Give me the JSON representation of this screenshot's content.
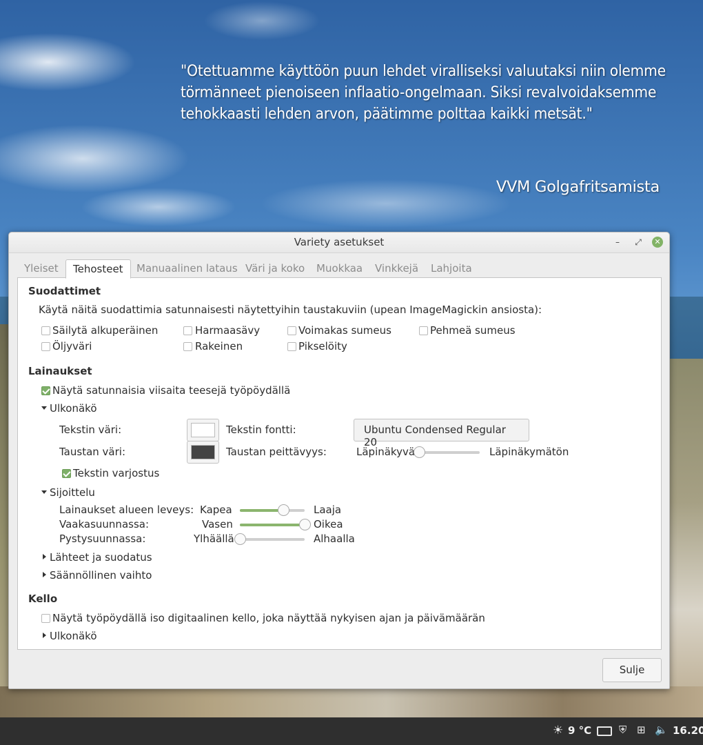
{
  "desktop": {
    "quote_text": "\"Otettuamme käyttöön puun lehdet viralliseksi valuutaksi niin olemme törmänneet pienoiseen inflaatio-ongelmaan. Siksi revalvoidaksemme tehokkaasti lehden arvon, päätimme polttaa kaikki metsät.\"",
    "quote_author": "VVM Golgafritsamista"
  },
  "window": {
    "title": "Variety asetukset",
    "controls": {
      "minimize": "–",
      "maximize": "⤢",
      "close": "✕"
    }
  },
  "tabs": [
    {
      "label": "Yleiset",
      "active": false
    },
    {
      "label": "Tehosteet",
      "active": true
    },
    {
      "label": "Manuaalinen lataus",
      "active": false
    },
    {
      "label": "Väri ja koko",
      "active": false
    },
    {
      "label": "Muokkaa",
      "active": false
    },
    {
      "label": "Vinkkejä",
      "active": false
    },
    {
      "label": "Lahjoita",
      "active": false
    }
  ],
  "filters": {
    "title": "Suodattimet",
    "description": "Käytä näitä suodattimia satunnaisesti näytettyihin taustakuviin (upean ImageMagickin ansiosta):",
    "options": [
      {
        "label": "Säilytä alkuperäinen",
        "checked": false
      },
      {
        "label": "Harmaasävy",
        "checked": false
      },
      {
        "label": "Voimakas sumeus",
        "checked": false
      },
      {
        "label": "Pehmeä sumeus",
        "checked": false
      },
      {
        "label": "Öljyväri",
        "checked": false
      },
      {
        "label": "Rakeinen",
        "checked": false
      },
      {
        "label": "Pikselöity",
        "checked": false
      }
    ]
  },
  "quotes": {
    "title": "Lainaukset",
    "show_quotes": {
      "label": "Näytä satunnaisia viisaita teesejä työpöydällä",
      "checked": true
    },
    "appearance": {
      "expander_label": "Ulkonäkö",
      "expanded": true,
      "text_color_label": "Tekstin väri:",
      "text_color": "#ffffff",
      "text_font_label": "Tekstin fontti:",
      "font_name": "Ubuntu Condensed Regular",
      "font_size": "20",
      "bg_color_label": "Taustan väri:",
      "bg_color": "#444444",
      "bg_opacity_label": "Taustan peittävyys:",
      "opacity_min_label": "Läpinäkyvä",
      "opacity_max_label": "Läpinäkymätön",
      "opacity_value": 0,
      "text_shadow": {
        "label": "Tekstin varjostus",
        "checked": true
      }
    },
    "placement": {
      "expander_label": "Sijoittelu",
      "expanded": true,
      "width_label": "Lainaukset alueen leveys:",
      "width_min": "Kapea",
      "width_max": "Laaja",
      "width_value": 0.67,
      "horizontal_label": "Vaakasuunnassa:",
      "horizontal_min": "Vasen",
      "horizontal_max": "Oikea",
      "horizontal_value": 1.0,
      "vertical_label": "Pystysuunnassa:",
      "vertical_min": "Ylhäällä",
      "vertical_max": "Alhaalla",
      "vertical_value": 0.0
    },
    "sources_expander": "Lähteet ja suodatus",
    "interval_expander": "Säännöllinen vaihto"
  },
  "clock": {
    "title": "Kello",
    "show_clock": {
      "label": "Näytä työpöydällä iso digitaalinen kello, joka näyttää nykyisen ajan ja päivämäärän",
      "checked": false
    },
    "appearance_expander": "Ulkonäkö"
  },
  "buttons": {
    "close": "Sulje"
  },
  "taskbar": {
    "weather_icon": "sun-icon",
    "temperature": "9 °C",
    "time": "16.20",
    "accent": "#8bb56e"
  }
}
